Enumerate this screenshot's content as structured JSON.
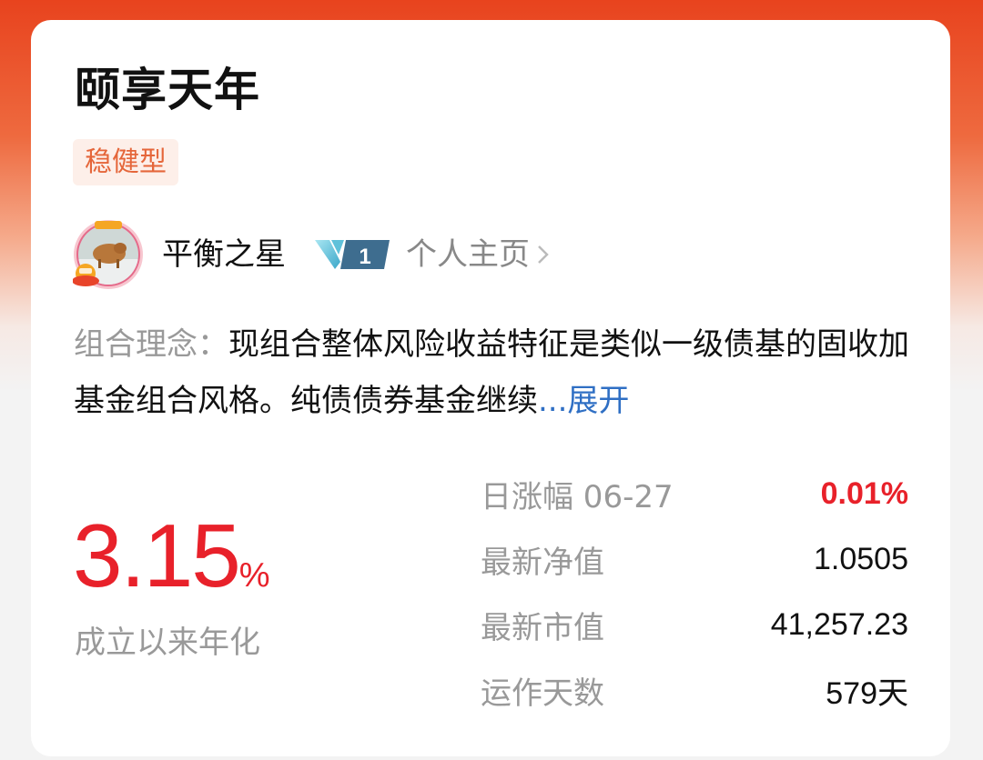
{
  "portfolio": {
    "title": "颐享天年",
    "risk_tag": "稳健型"
  },
  "author": {
    "name": "平衡之星",
    "level": "1",
    "homepage_label": "个人主页"
  },
  "concept": {
    "label": "组合理念：",
    "text": "现组合整体风险收益特征是类似一级债基的固收加基金组合风格。纯债债券基金继续",
    "expand_label": "...展开"
  },
  "annualized_return": {
    "value": "3.15",
    "unit": "%",
    "label": "成立以来年化"
  },
  "stats": [
    {
      "label": "日涨幅 06-27",
      "value": "0.01%"
    },
    {
      "label": "最新净值",
      "value": "1.0505"
    },
    {
      "label": "最新市值",
      "value": "41,257.23"
    },
    {
      "label": "运作天数",
      "value": "579",
      "unit": "天"
    }
  ],
  "colors": {
    "header_orange": "#E8431E",
    "return_red": "#E8212A",
    "tag_text": "#E5663A",
    "tag_bg": "#FDEFE9",
    "link_blue": "#2F6FC4"
  },
  "icons": {
    "avatar": "avatar-image",
    "level_badge": "v-level-badge",
    "chevron": "chevron-right-icon"
  }
}
